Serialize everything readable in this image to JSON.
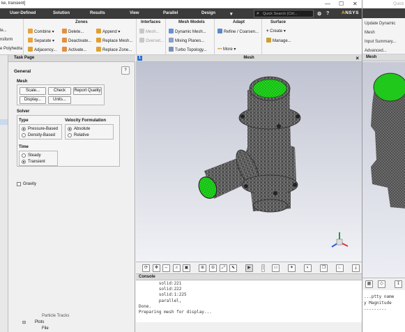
{
  "window": {
    "title": "ke, transient]"
  },
  "menu": [
    "User-Defined",
    "Solution",
    "Results",
    "View",
    "Parallel",
    "Design"
  ],
  "quick_search": {
    "placeholder": "Quick Search (Ctrl..."
  },
  "brand": "ANSYS",
  "ribbon": {
    "left_cut": {
      "items": [
        "le...",
        "nsform",
        "e Polyhedra"
      ]
    },
    "zones": {
      "header": "Zones",
      "items": [
        "Combine",
        "Separate",
        "Adjacency...",
        "Delete...",
        "Deactivate...",
        "Activate...",
        "Append",
        "Replace Mesh...",
        "Replace Zone..."
      ]
    },
    "interfaces": {
      "header": "Interfaces",
      "items": [
        "Mesh...",
        "Overset..."
      ]
    },
    "mesh_models": {
      "header": "Mesh Models",
      "items": [
        "Dynamic Mesh...",
        "Mixing Planes...",
        "Turbo Topology..."
      ]
    },
    "adapt": {
      "header": "Adapt",
      "items": [
        "Refine / Coarsen...",
        "More"
      ]
    },
    "surface": {
      "header": "Surface",
      "items": [
        "Create",
        "Manage..."
      ]
    }
  },
  "task_page": {
    "header": "Task Page",
    "title": "General",
    "help": "?",
    "mesh": {
      "label": "Mesh",
      "buttons": [
        "Scale...",
        "Check",
        "Report Quality",
        "Display...",
        "Units..."
      ]
    },
    "solver": {
      "label": "Solver",
      "type": {
        "label": "Type",
        "options": [
          "Pressure-Based",
          "Density-Based"
        ],
        "selected": "Pressure-Based"
      },
      "velocity": {
        "label": "Velocity Formulation",
        "options": [
          "Absolute",
          "Relative"
        ],
        "selected": "Absolute"
      },
      "time": {
        "label": "Time",
        "options": [
          "Steady",
          "Transient"
        ],
        "selected": "Transient"
      }
    },
    "gravity": {
      "label": "Gravity",
      "checked": false
    }
  },
  "graphics": {
    "tab": "1",
    "title": "Mesh",
    "close": "×"
  },
  "console": {
    "header": "Console",
    "lines": [
      "        solid:221",
      "        solid:222",
      "        solid:1:225",
      "        parallel,",
      "Done.",
      "",
      "Preparing mesh for display..."
    ]
  },
  "tree": {
    "items": [
      "Particle Tracks",
      "Plots",
      "File"
    ]
  },
  "bg_window": {
    "menu_search": "Quick",
    "ribbon": [
      "Update Dynamic Mesh",
      "Input Summary...",
      "Advanced..."
    ],
    "mesh_title": "Mesh",
    "console": [
      "...ptty name",
      "",
      "y Magnitude",
      "",
      "---------"
    ]
  },
  "colors": {
    "menubar": "#3b3b3b",
    "accent": "#ffb71b",
    "mesh_inlet": "#22d61e",
    "mesh_body": "#4a4a4a"
  }
}
